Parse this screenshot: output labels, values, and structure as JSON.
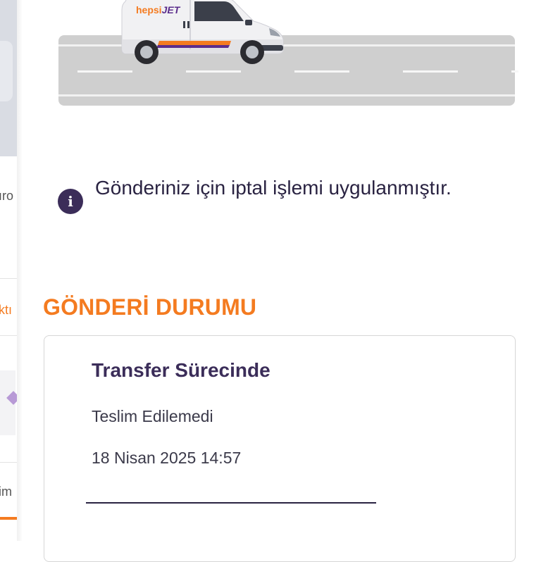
{
  "background_page": {
    "fragments": [
      "ıro",
      "ktı",
      "im"
    ]
  },
  "van": {
    "brand_part1": "hepsi",
    "brand_part2": "JET"
  },
  "info": {
    "icon": "info-icon",
    "icon_glyph": "i",
    "message": "Gönderiniz için iptal işlemi uygulanmıştır."
  },
  "section": {
    "title": "GÖNDERİ DURUMU"
  },
  "status_card": {
    "title": "Transfer Sürecinde",
    "status": "Teslim Edilemedi",
    "date": "18 Nisan 2025 14:57"
  },
  "colors": {
    "accent": "#f47b20",
    "primary_dark": "#3b2d59",
    "road": "#cfcfcf"
  }
}
